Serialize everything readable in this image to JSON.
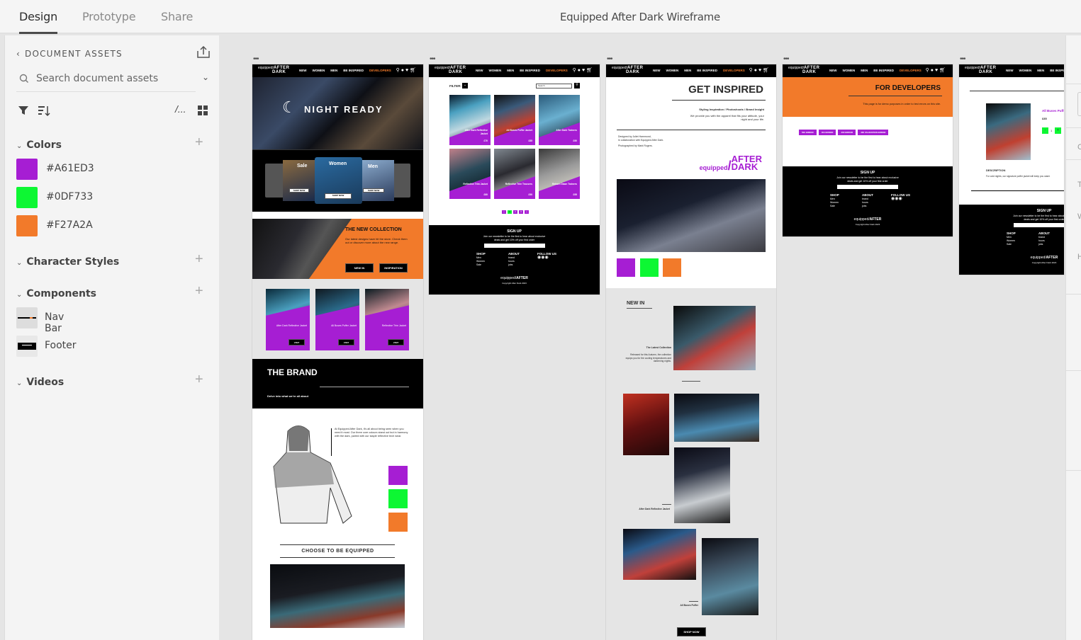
{
  "topbar": {
    "tabs": [
      {
        "label": "Design",
        "active": true
      },
      {
        "label": "Prototype",
        "active": false
      },
      {
        "label": "Share",
        "active": false
      }
    ],
    "document_title": "Equipped After Dark Wireframe"
  },
  "sidebar": {
    "header": "DOCUMENT ASSETS",
    "search_placeholder": "Search document assets",
    "sections": {
      "colors": {
        "label": "Colors",
        "items": [
          {
            "hex": "#A61ED3",
            "label": "#A61ED3"
          },
          {
            "hex": "#0DF733",
            "label": "#0DF733"
          },
          {
            "hex": "#F27A2A",
            "label": "#F27A2A"
          }
        ]
      },
      "character_styles": {
        "label": "Character Styles"
      },
      "components": {
        "label": "Components",
        "items": [
          {
            "label": "Nav Bar"
          },
          {
            "label": "Footer"
          }
        ]
      },
      "videos": {
        "label": "Videos"
      }
    }
  },
  "brand": {
    "logo_small": "equipped",
    "logo_big1": "AFTER",
    "logo_big2": "DARK",
    "nav_links": [
      "NEW",
      "WOMEN",
      "MEN",
      "BE INSPIRED",
      "DEVELOPERS"
    ],
    "purple": "#A61ED3",
    "green": "#0DF733",
    "orange": "#F27A2A"
  },
  "home": {
    "hero_title": "NIGHT READY",
    "carousel": [
      {
        "label": "Sale",
        "button": "SHOP NOW"
      },
      {
        "label": "Women",
        "button": "SHOP NOW"
      },
      {
        "label": "Men",
        "button": "SHOP NOW"
      }
    ],
    "collection_title": "THE NEW COLLECTION",
    "collection_text": "Our latest designs have hit the store. Check them out or discover more about the new range.",
    "collection_buttons": [
      "NEW IN",
      "INSPIRATION"
    ],
    "featured": [
      {
        "name": "After Dark Reflective Jacket",
        "button": "VISIT"
      },
      {
        "name": "All Buses Puffer Jacket",
        "button": "VISIT"
      },
      {
        "name": "Reflective Trim Jacket",
        "button": "VISIT"
      }
    ],
    "brand_title": "THE BRAND",
    "brand_sub": "Delve into what we're all about",
    "brand_text": "At Equipped After Dark, it's all about being seen when you need it most. Our three core colours stand out but in harmony with the dark, paired with our staple reflective tech wear.",
    "choose_title": "CHOOSE TO BE EQUIPPED"
  },
  "shop": {
    "filter_label": "FILTER:",
    "search_value": "Search",
    "products": [
      {
        "name": "After Dark Reflective Jacket",
        "price": "£70"
      },
      {
        "name": "All Buses Puffer Jacket",
        "price": "£85"
      },
      {
        "name": "After Dark Trainers",
        "price": "£90"
      },
      {
        "name": "Reflective Trim Jacket",
        "price": "£60"
      },
      {
        "name": "Reflective Trim Trousers",
        "price": "£90"
      },
      {
        "name": "Reborn Dawn Trainers",
        "price": "£95"
      }
    ],
    "pages": [
      "«",
      "1",
      "2",
      "3",
      "»"
    ]
  },
  "footer": {
    "signup_title": "SIGN UP",
    "signup_text": "Join our newsletter to be the first to hear about exclusive deals and get 10% off your first order",
    "shop_title": "SHOP",
    "shop_links": [
      "Men",
      "Women",
      "Sale"
    ],
    "about_title": "ABOUT",
    "about_links": [
      "brand",
      "hours",
      "jobs"
    ],
    "follow_title": "FOLLOW US",
    "copyright": "Copyright After Dark 2023"
  },
  "inspired": {
    "title": "GET INSPIRED",
    "subtitle": "Styling Inspiration / Photoshoots / Brand Insight",
    "tagline": "We provide you with the apparel that fits your attitude, your night and your life.",
    "credit1": "Designed by Juliet Hammond,",
    "credit2": "In collaboration with Equipped After Dark.",
    "credit3": "Photographed by Mark Rogers.",
    "new_in_title": "NEW IN",
    "latest_title": "The Latest Collection",
    "latest_text": "Released for this Autumn, the collection equips you for the cooling temperatures and darkening nights.",
    "caption1": "After Dark Reflective Jacket",
    "caption2": "All Buses Puffer",
    "shop_now": "SHOP NOW"
  },
  "developers": {
    "title": "FOR DEVELOPERS",
    "text": "This page is for demo purposes in order to test errors on this site.",
    "buttons": [
      "500 ERROR",
      "404 ERROR",
      "400 ERROR",
      "400 VALIDATION ERROR"
    ]
  },
  "product": {
    "name": "All Buses Puffer Jacket",
    "price": "£85",
    "qty": "1",
    "desc_title": "DESCRIPTION",
    "desc_text": "For cold nights, our signature puffer jacket will keep you warm"
  }
}
